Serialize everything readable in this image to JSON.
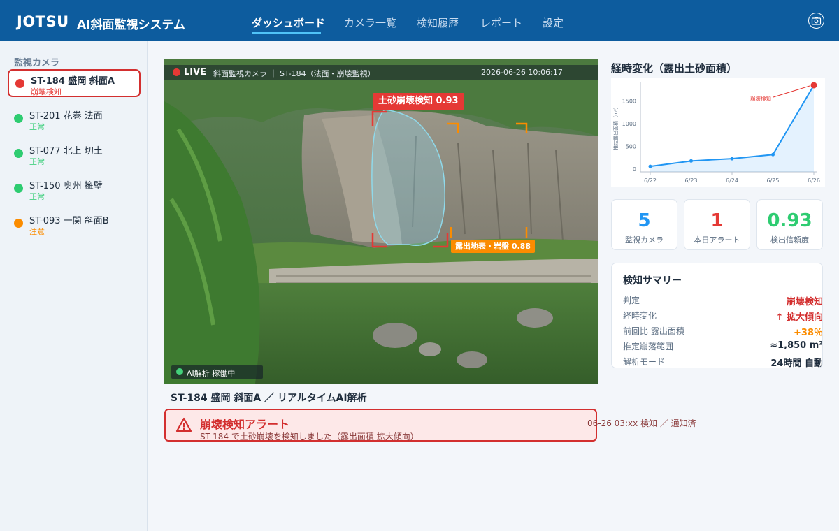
{
  "header": {
    "logo": "JOTSU",
    "title": "AI斜面監視システム",
    "nav": [
      "ダッシュボード",
      "カメラ一覧",
      "検知履歴",
      "レポート",
      "設定"
    ],
    "active_nav": "ダッシュボード"
  },
  "sidebar": {
    "title": "監視カメラ",
    "cameras": [
      {
        "name": "ST-184  盛岡 斜面A",
        "status": "崩壊検知",
        "color": "#e53935",
        "selected": true
      },
      {
        "name": "ST-201  花巻 法面",
        "status": "正常",
        "color": "#2ecc71"
      },
      {
        "name": "ST-077  北上 切土",
        "status": "正常",
        "color": "#2ecc71"
      },
      {
        "name": "ST-150  奥州 擁壁",
        "status": "正常",
        "color": "#2ecc71"
      },
      {
        "name": "ST-093  一関 斜面B",
        "status": "注意",
        "color": "#fb8c00"
      }
    ]
  },
  "video": {
    "live": "LIVE",
    "caption": "斜面監視カメラ ｜ ST-184（法面・崩壊監視）",
    "timestamp": "2026-06-26 10:06:17",
    "detection_main": "土砂崩壊検知  0.93",
    "detection_sub": "露出地表・岩盤  0.88",
    "ai_status": "AI解析 稼働中",
    "title": "ST-184 盛岡 斜面A ／ リアルタイムAI解析"
  },
  "alert": {
    "title": "崩壊検知アラート",
    "message": "ST-184 で土砂崩壊を検知しました（露出面積 拡大傾向）",
    "time": "06-26 03:xx 検知 ／ 通知済"
  },
  "chart_title": "経時変化（露出土砂面積）",
  "chart_data": {
    "type": "line",
    "title": "経時変化（露出土砂面積）",
    "ylabel": "推定露出面積（m²）",
    "categories": [
      "6/22",
      "6/23",
      "6/24",
      "6/25",
      "6/26"
    ],
    "series": [
      {
        "values": [
          60,
          180,
          230,
          320,
          1850
        ]
      }
    ],
    "ylim": [
      0,
      1850
    ],
    "yticks": [
      0,
      500,
      1000,
      1500
    ],
    "annotation": "崩壊検知",
    "line_color": "#2196f3",
    "highlight_color": "#e53935",
    "grid": false
  },
  "stats": [
    {
      "value": "5",
      "label": "監視カメラ",
      "color": "#2196f3"
    },
    {
      "value": "1",
      "label": "本日アラート",
      "color": "#e53935"
    },
    {
      "value": "0.93",
      "label": "検出信頼度",
      "color": "#2ecc71"
    }
  ],
  "summary": {
    "title": "検知サマリー",
    "rows": [
      {
        "key": "判定",
        "value": "崩壊検知",
        "color": "#d32f2f"
      },
      {
        "key": "経時変化",
        "value": "↑ 拡大傾向",
        "color": "#d32f2f"
      },
      {
        "key": "前回比 露出面積",
        "value": "+38％",
        "color": "#fb8c00"
      },
      {
        "key": "推定崩落範囲",
        "value": "≈1,850 m²",
        "color": "#1f2d3d"
      },
      {
        "key": "解析モード",
        "value": "24時間 自動",
        "color": "#1f2d3d"
      }
    ]
  }
}
